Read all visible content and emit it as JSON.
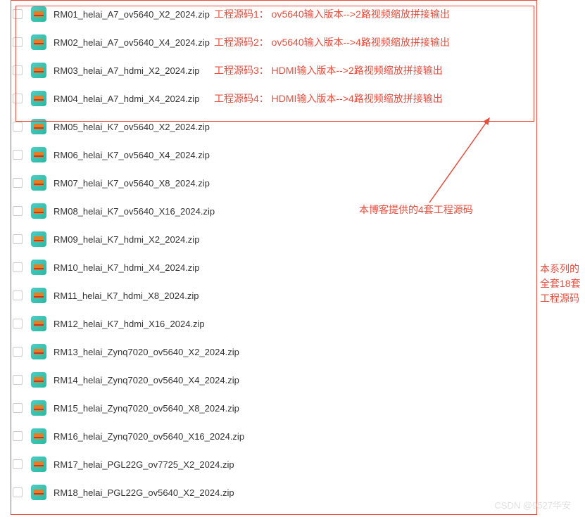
{
  "files": [
    {
      "name": "RM01_helai_A7_ov5640_X2_2024.zip",
      "note": "工程源码1：  ov5640输入版本-->2路视频缩放拼接输出"
    },
    {
      "name": "RM02_helai_A7_ov5640_X4_2024.zip",
      "note": "工程源码2：  ov5640输入版本-->4路视频缩放拼接输出"
    },
    {
      "name": "RM03_helai_A7_hdmi_X2_2024.zip",
      "note": "工程源码3：  HDMI输入版本-->2路视频缩放拼接输出"
    },
    {
      "name": "RM04_helai_A7_hdmi_X4_2024.zip",
      "note": "工程源码4：  HDMI输入版本-->4路视频缩放拼接输出"
    },
    {
      "name": "RM05_helai_K7_ov5640_X2_2024.zip",
      "note": ""
    },
    {
      "name": "RM06_helai_K7_ov5640_X4_2024.zip",
      "note": ""
    },
    {
      "name": "RM07_helai_K7_ov5640_X8_2024.zip",
      "note": ""
    },
    {
      "name": "RM08_helai_K7_ov5640_X16_2024.zip",
      "note": ""
    },
    {
      "name": "RM09_helai_K7_hdmi_X2_2024.zip",
      "note": ""
    },
    {
      "name": "RM10_helai_K7_hdmi_X4_2024.zip",
      "note": ""
    },
    {
      "name": "RM11_helai_K7_hdmi_X8_2024.zip",
      "note": ""
    },
    {
      "name": "RM12_helai_K7_hdmi_X16_2024.zip",
      "note": ""
    },
    {
      "name": "RM13_helai_Zynq7020_ov5640_X2_2024.zip",
      "note": ""
    },
    {
      "name": "RM14_helai_Zynq7020_ov5640_X4_2024.zip",
      "note": ""
    },
    {
      "name": "RM15_helai_Zynq7020_ov5640_X8_2024.zip",
      "note": ""
    },
    {
      "name": "RM16_helai_Zynq7020_ov5640_X16_2024.zip",
      "note": ""
    },
    {
      "name": "RM17_helai_PGL22G_ov7725_X2_2024.zip",
      "note": ""
    },
    {
      "name": "RM18_helai_PGL22G_ov5640_X2_2024.zip",
      "note": ""
    }
  ],
  "callout_label": "本博客提供的4套工程源码",
  "side_label": "本系列的全套18套工程源码",
  "watermark": "CSDN @9527华安"
}
